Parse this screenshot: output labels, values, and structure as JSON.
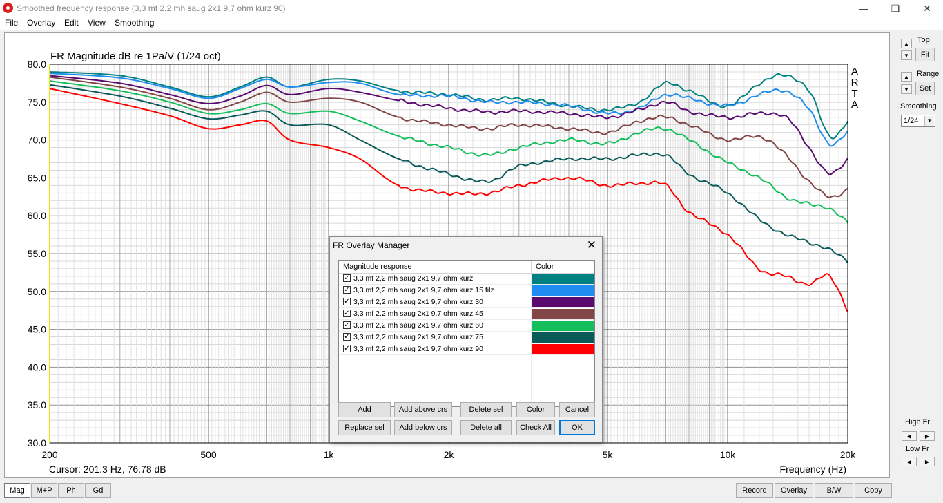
{
  "window": {
    "title": "Smoothed frequency response (3,3 mf 2,2 mh saug 2x1 9,7 ohm kurz 90)"
  },
  "menu": [
    "File",
    "Overlay",
    "Edit",
    "View",
    "Smoothing"
  ],
  "plot": {
    "title": "FR Magnitude dB re 1Pa/V (1/24 oct)",
    "arta_letters": [
      "A",
      "R",
      "T",
      "A"
    ],
    "cursor": "Cursor: 201.3 Hz, 76.78 dB",
    "xlabel": "Frequency (Hz)"
  },
  "side": {
    "top_label": "Top",
    "fit_label": "Fit",
    "range_label": "Range",
    "set_label": "Set",
    "smoothing_label": "Smoothing",
    "smoothing_value": "1/24",
    "highfr_label": "High Fr",
    "lowfr_label": "Low Fr"
  },
  "bottom_tabs": [
    "Mag",
    "M+P",
    "Ph",
    "Gd"
  ],
  "bottom_buttons": [
    "Record",
    "Overlay",
    "B/W",
    "Copy"
  ],
  "dialog": {
    "title": "FR Overlay Manager",
    "col_name": "Magnitude response",
    "col_color": "Color",
    "rows": [
      {
        "label": "3,3 mf 2,2 mh saug 2x1 9,7 ohm kurz",
        "color": "#008080"
      },
      {
        "label": "3,3 mf 2,2 mh saug 2x1 9,7 ohm kurz 15 filz",
        "color": "#1e8cf0"
      },
      {
        "label": "3,3 mf 2,2 mh saug 2x1 9,7 ohm kurz 30",
        "color": "#5a0a6e"
      },
      {
        "label": "3,3 mf 2,2 mh saug 2x1 9,7 ohm kurz 45",
        "color": "#824646"
      },
      {
        "label": "3,3 mf 2,2 mh saug 2x1 9,7 ohm kurz 60",
        "color": "#14be5a"
      },
      {
        "label": "3,3 mf 2,2 mh saug 2x1 9,7 ohm kurz 75",
        "color": "#0a5a5a"
      },
      {
        "label": "3,3 mf 2,2 mh saug 2x1 9,7 ohm kurz 90",
        "color": "#ff0000"
      }
    ],
    "buttons_row1": [
      "Add",
      "Add above crs",
      "Delete sel",
      "Color",
      "Cancel"
    ],
    "buttons_row2": [
      "Replace sel",
      "Add below crs",
      "Delete all",
      "Check All",
      "OK"
    ]
  },
  "chart_data": {
    "type": "line",
    "title": "FR Magnitude dB re 1Pa/V (1/24 oct)",
    "xlabel": "Frequency (Hz)",
    "ylabel": "",
    "xscale": "log",
    "xlim": [
      200,
      20000
    ],
    "ylim": [
      30,
      80
    ],
    "x_ticks": [
      "200",
      "500",
      "1k",
      "2k",
      "5k",
      "10k",
      "20k"
    ],
    "y_ticks": [
      "80.0",
      "75.0",
      "70.0",
      "65.0",
      "60.0",
      "55.0",
      "50.0",
      "45.0",
      "40.0",
      "35.0",
      "30.0"
    ],
    "grid": true,
    "x": [
      200,
      300,
      400,
      500,
      600,
      700,
      800,
      1000,
      1200,
      1500,
      2000,
      2500,
      3000,
      4000,
      5000,
      6000,
      7000,
      8000,
      10000,
      12000,
      14000,
      16000,
      18000,
      20000
    ],
    "series": [
      {
        "name": "3,3 mf 2,2 mh saug 2x1 9,7 ohm kurz",
        "color": "#008080",
        "values": [
          79.0,
          78.5,
          77.0,
          75.7,
          77.0,
          78.3,
          77.0,
          78.0,
          77.8,
          76.5,
          76.0,
          75.3,
          75.5,
          74.5,
          74.0,
          75.0,
          77.5,
          76.5,
          74.5,
          77.5,
          78.5,
          76.5,
          70.5,
          72.5
        ]
      },
      {
        "name": "3,3 mf 2,2 mh saug 2x1 9,7 ohm kurz 15 filz",
        "color": "#1e8cf0",
        "values": [
          78.8,
          78.2,
          76.8,
          75.5,
          76.8,
          78.0,
          77.0,
          77.6,
          77.5,
          76.0,
          75.8,
          75.0,
          75.0,
          74.5,
          73.5,
          74.2,
          76.0,
          75.5,
          74.5,
          76.0,
          76.5,
          74.0,
          69.5,
          71.0
        ]
      },
      {
        "name": "3,3 mf 2,2 mh saug 2x1 9,7 ohm kurz 30",
        "color": "#5a0a6e",
        "values": [
          78.5,
          77.5,
          76.0,
          74.8,
          75.8,
          77.2,
          76.0,
          76.8,
          76.3,
          75.2,
          74.2,
          73.7,
          73.8,
          73.5,
          73.0,
          74.0,
          75.0,
          73.8,
          73.0,
          73.5,
          73.0,
          69.0,
          65.5,
          67.5
        ]
      },
      {
        "name": "3,3 mf 2,2 mh saug 2x1 9,7 ohm kurz 45",
        "color": "#824646",
        "values": [
          78.3,
          77.0,
          75.5,
          74.0,
          75.0,
          76.3,
          75.0,
          75.5,
          75.0,
          73.0,
          72.0,
          71.5,
          72.0,
          71.5,
          71.0,
          72.5,
          73.0,
          72.0,
          70.0,
          70.5,
          68.0,
          64.5,
          62.5,
          63.5
        ]
      },
      {
        "name": "3,3 mf 2,2 mh saug 2x1 9,7 ohm kurz 60",
        "color": "#14be5a",
        "values": [
          77.8,
          76.5,
          75.0,
          73.5,
          74.0,
          74.8,
          73.5,
          73.8,
          72.5,
          70.5,
          69.0,
          68.0,
          69.0,
          70.0,
          69.5,
          71.0,
          71.5,
          70.0,
          67.0,
          65.0,
          62.5,
          61.5,
          61.0,
          59.0
        ]
      },
      {
        "name": "3,3 mf 2,2 mh saug 2x1 9,7 ohm kurz 75",
        "color": "#0a5a5a",
        "values": [
          77.3,
          75.8,
          74.2,
          72.8,
          73.3,
          73.8,
          72.0,
          72.0,
          70.0,
          67.5,
          65.5,
          64.5,
          66.5,
          67.5,
          67.5,
          68.0,
          68.0,
          65.5,
          63.0,
          59.5,
          57.5,
          56.5,
          55.5,
          54.0
        ]
      },
      {
        "name": "3,3 mf 2,2 mh saug 2x1 9,7 ohm kurz 90",
        "color": "#ff0000",
        "values": [
          76.8,
          74.8,
          73.2,
          71.5,
          72.0,
          72.5,
          70.0,
          69.0,
          67.5,
          64.0,
          63.0,
          63.0,
          64.0,
          65.0,
          64.0,
          64.3,
          64.0,
          60.5,
          57.5,
          53.0,
          52.0,
          51.0,
          52.0,
          47.5
        ]
      }
    ]
  }
}
